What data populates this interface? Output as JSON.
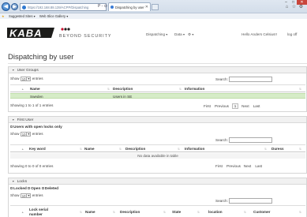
{
  "browser": {
    "address": "https://192.168.88.139/ACPP/Dispatching",
    "address_tools": "P - ⊙ ✕",
    "tab_title": "Dispatching by user",
    "tab_close": "✕",
    "favorites": [
      "Suggested Sites ▾",
      "Web Slice Gallery ▾"
    ]
  },
  "app": {
    "brand": "KABA",
    "tagline": "BEYOND SECURITY",
    "menu": [
      {
        "label": "Dispatching",
        "caret": "▾"
      },
      {
        "label": "Data",
        "caret": "▾"
      },
      {
        "label": "⚙",
        "caret": "▾"
      }
    ],
    "greeting": "Hello Anders Celsius!!",
    "logoff": "log off"
  },
  "page": {
    "title": "Dispatching by user"
  },
  "user_groups": {
    "header": "User Groups",
    "show_label": "Show",
    "show_value": "10",
    "entries_label": "entries",
    "search_label": "Search:",
    "columns": [
      "Name",
      "Description",
      "Information"
    ],
    "rows": [
      {
        "name": "Sweden",
        "description": "Users in SE",
        "information": ""
      }
    ],
    "info": "Showing 1 to 1 of 1 entries",
    "pager": {
      "first": "First",
      "previous": "Previous",
      "current": "1",
      "next": "Next",
      "last": "Last"
    }
  },
  "first_user": {
    "header": "First User",
    "filter": "Users with open locks only",
    "show_label": "Show",
    "show_value": "10",
    "entries_label": "entries",
    "search_label": "Search:",
    "columns": [
      "Key word",
      "Name",
      "Description",
      "Information",
      "Duress"
    ],
    "empty": "No data available in table",
    "info": "Showing 0 to 0 of 0 entries",
    "pager": {
      "first": "First",
      "previous": "Previous",
      "next": "Next",
      "last": "Last"
    }
  },
  "locks": {
    "header": "Locks",
    "filter_parts": [
      "Locked",
      "Open",
      "Deleted"
    ],
    "show_label": "Show",
    "show_value": "10",
    "entries_label": "entries",
    "search_label": "Search:",
    "columns": [
      "Lock serial number",
      "Name",
      "Description",
      "State",
      "location",
      "Customer"
    ]
  },
  "colors": {
    "selected_row": "#d6ecc7",
    "panel_header": "#f1f1f1",
    "brand_red": "#c8102e",
    "brand_text": "#1d1d1b"
  }
}
